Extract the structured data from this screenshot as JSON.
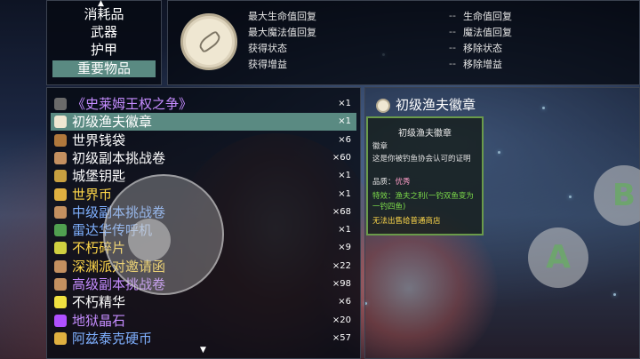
{
  "categories": {
    "items": [
      "消耗品",
      "武器",
      "护甲",
      "重要物品"
    ],
    "selected_index": 3
  },
  "effects": [
    {
      "label": "最大生命值回复",
      "value": "生命值回复"
    },
    {
      "label": "最大魔法值回复",
      "value": "魔法值回复"
    },
    {
      "label": "获得状态",
      "value": "移除状态"
    },
    {
      "label": "获得增益",
      "value": "移除增益"
    }
  ],
  "effect_dash": "--",
  "items": [
    {
      "name": "《史莱姆王权之争》",
      "count": "×1",
      "color": "#c58cff",
      "icon": "book-icon",
      "icon_color": "#6a6a6a"
    },
    {
      "name": "初级渔夫徽章",
      "count": "×1",
      "color": "#ffffff",
      "icon": "badge-icon",
      "icon_color": "#efe7d2"
    },
    {
      "name": "世界钱袋",
      "count": "×6",
      "color": "#ffffff",
      "icon": "pouch-icon",
      "icon_color": "#b0783c"
    },
    {
      "name": "初级副本挑战卷",
      "count": "×60",
      "color": "#ffffff",
      "icon": "scroll-icon",
      "icon_color": "#c49060"
    },
    {
      "name": "城堡钥匙",
      "count": "×1",
      "color": "#ffffff",
      "icon": "key-icon",
      "icon_color": "#c8a040"
    },
    {
      "name": "世界币",
      "count": "×1",
      "color": "#ffd84a",
      "icon": "coin-icon",
      "icon_color": "#e0b040"
    },
    {
      "name": "中级副本挑战卷",
      "count": "×68",
      "color": "#7fb0ff",
      "icon": "scroll-icon",
      "icon_color": "#c49060"
    },
    {
      "name": "雷达华传呼机",
      "count": "×1",
      "color": "#7fb0ff",
      "icon": "pager-icon",
      "icon_color": "#50a050"
    },
    {
      "name": "不朽碎片",
      "count": "×9",
      "color": "#ffd84a",
      "icon": "shard-icon",
      "icon_color": "#d0d040"
    },
    {
      "name": "深渊派对邀请函",
      "count": "×22",
      "color": "#ffd84a",
      "icon": "letter-icon",
      "icon_color": "#c49060"
    },
    {
      "name": "高级副本挑战卷",
      "count": "×98",
      "color": "#c58cff",
      "icon": "scroll-icon",
      "icon_color": "#c49060"
    },
    {
      "name": "不朽精华",
      "count": "×6",
      "color": "#ffffff",
      "icon": "essence-icon",
      "icon_color": "#f0e040"
    },
    {
      "name": "地狱晶石",
      "count": "×20",
      "color": "#c58cff",
      "icon": "crystal-icon",
      "icon_color": "#b050ff"
    },
    {
      "name": "阿兹泰克硬币",
      "count": "×57",
      "color": "#7fb0ff",
      "icon": "coin-icon",
      "icon_color": "#e0b040"
    }
  ],
  "selected_item_index": 1,
  "detail": {
    "title": "初级渔夫徽章",
    "card_title": "初级渔夫徽章",
    "type": "徽章",
    "desc": "这是你被钓鱼协会认可的证明",
    "quality_label": "品质：",
    "quality": "优秀",
    "trait_label": "特效：",
    "trait": "渔夫之利(一钓双鱼变为一钓四鱼)",
    "note": "无法出售给普通商店"
  },
  "controls": {
    "a": "A",
    "b": "B"
  },
  "colors": {
    "selection": "#5a8a82",
    "card_border": "#6a9a4a",
    "trait_green": "#7ddc4a",
    "note_yellow": "#ffd84a",
    "quality": "#ff9ec8"
  }
}
